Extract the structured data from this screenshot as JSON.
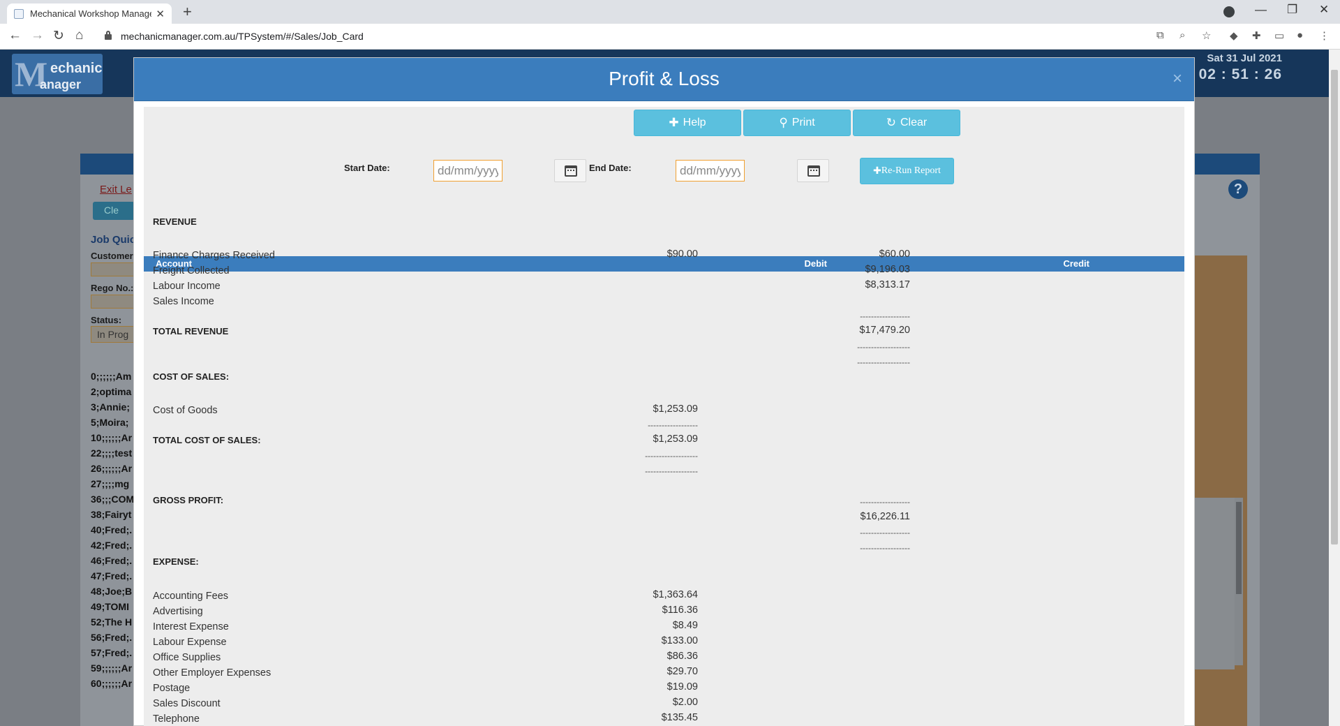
{
  "browser": {
    "tab_title": "Mechanical Workshop Managem",
    "url": "mechanicmanager.com.au/TPSystem/#/Sales/Job_Card"
  },
  "app": {
    "logo_line1": "echanic",
    "logo_line2": "anager",
    "logo_letter": "M",
    "date": "Sat 31 Jul 2021",
    "time": "02 : 51 : 26"
  },
  "background": {
    "links": "Exit  Le",
    "clear_label": "Cle",
    "section_title": "Job Quic",
    "customer_label": "Customer",
    "rego_label": "Rego No.:",
    "status_label": "Status:",
    "status_value": "In Prog",
    "jobs": [
      "0;;;;;;Am",
      "2;optima",
      "3;Annie;",
      "5;Moira;",
      "10;;;;;;Ar",
      "22;;;;test",
      "26;;;;;;Ar",
      "27;;;;mg",
      "36;;;COM",
      "38;Fairyt",
      "40;Fred;.",
      "42;Fred;.",
      "46;Fred;.",
      "47;Fred;.",
      "48;Joe;B",
      "49;TOMI",
      "52;The H",
      "56;Fred;.",
      "57;Fred;.",
      "59;;;;;;Ar",
      "60;;;;;;Ar"
    ]
  },
  "modal": {
    "title": "Profit & Loss",
    "help_label": "Help",
    "print_label": "Print",
    "clear_label": "Clear",
    "start_date_label": "Start Date:",
    "end_date_label": "End Date:",
    "date_placeholder": "dd/mm/yyyy",
    "rerun_label": "Re-Run Report"
  },
  "report": {
    "columns": {
      "account": "Account",
      "debit": "Debit",
      "credit": "Credit"
    },
    "revenue_title": "REVENUE",
    "revenue_rows": [
      {
        "account": "Finance Charges Received",
        "debit": "$90.00",
        "credit": "$60.00"
      },
      {
        "account": "Freight Collected",
        "debit": "",
        "credit": "$9,196.03"
      },
      {
        "account": "Labour Income",
        "debit": "",
        "credit": "$8,313.17"
      },
      {
        "account": "Sales Income",
        "debit": "",
        "credit": ""
      }
    ],
    "total_revenue_label": "TOTAL REVENUE",
    "total_revenue_credit": "$17,479.20",
    "cost_title": "COST OF SALES:",
    "cost_rows": [
      {
        "account": "Cost of Goods",
        "debit": "$1,253.09",
        "credit": ""
      }
    ],
    "total_cost_label": "TOTAL COST OF SALES:",
    "total_cost_debit": "$1,253.09",
    "gross_profit_label": "GROSS PROFIT:",
    "gross_profit_credit": "$16,226.11",
    "expense_title": "EXPENSE:",
    "expense_rows": [
      {
        "account": "Accounting Fees",
        "debit": "$1,363.64"
      },
      {
        "account": "Advertising",
        "debit": "$116.36"
      },
      {
        "account": "Interest Expense",
        "debit": "$8.49"
      },
      {
        "account": "Labour Expense",
        "debit": "$133.00"
      },
      {
        "account": "Office Supplies",
        "debit": "$86.36"
      },
      {
        "account": "Other Employer Expenses",
        "debit": "$29.70"
      },
      {
        "account": "Postage",
        "debit": "$19.09"
      },
      {
        "account": "Sales Discount",
        "debit": "$2.00"
      },
      {
        "account": "Telephone",
        "debit": "$135.45"
      }
    ]
  }
}
